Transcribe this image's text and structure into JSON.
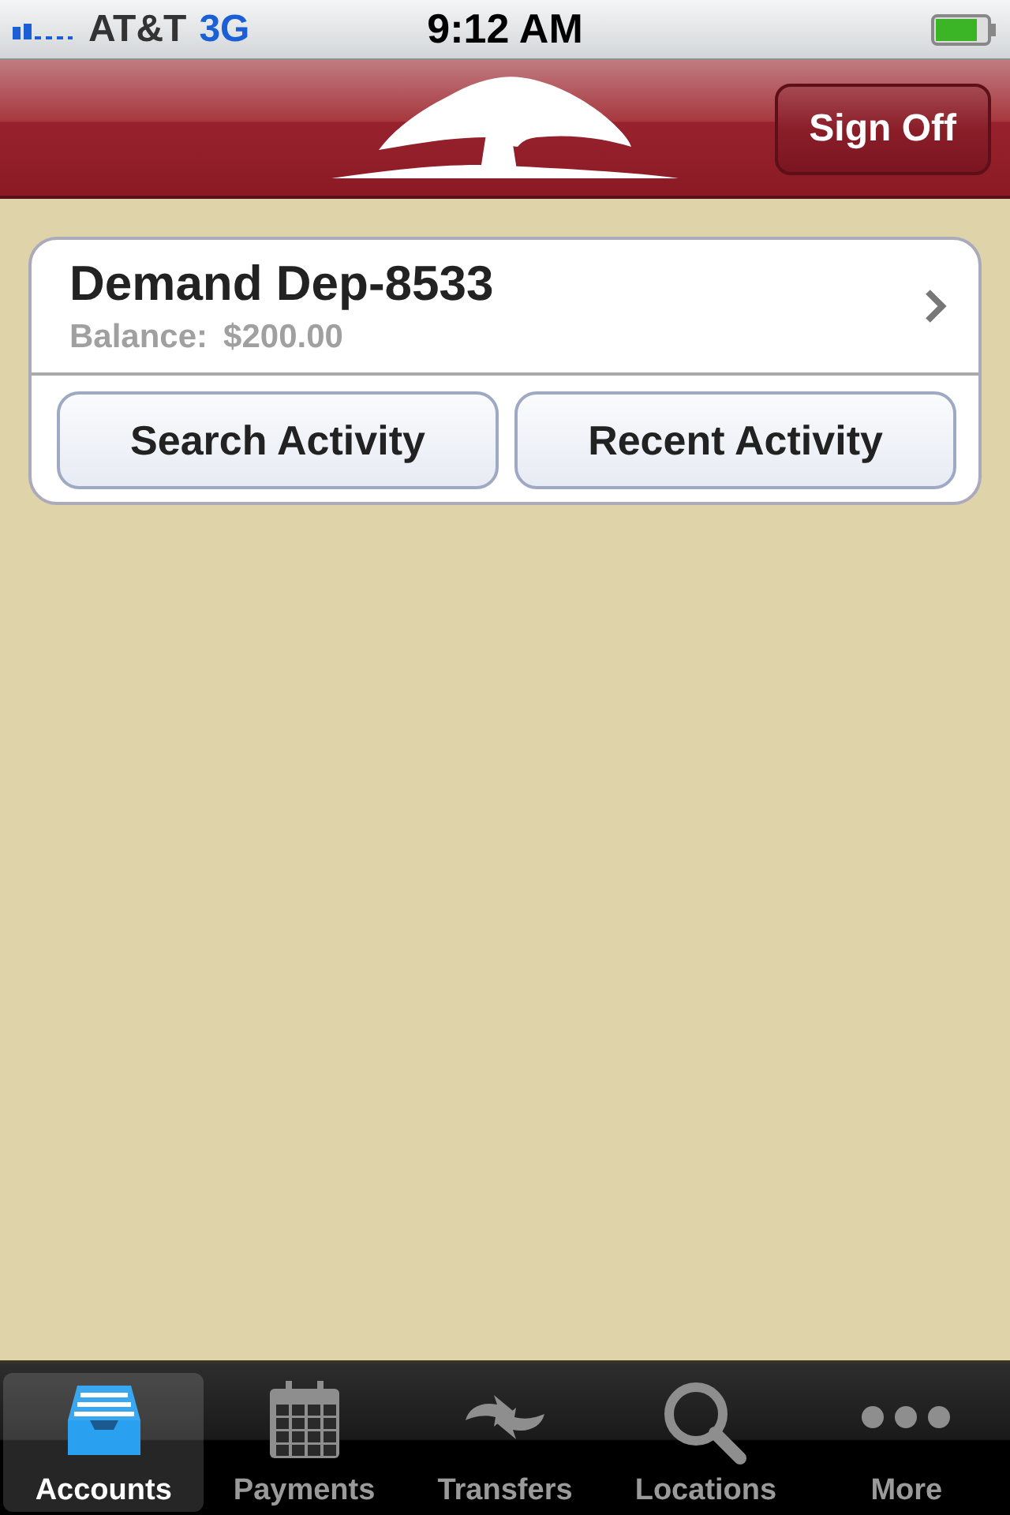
{
  "status_bar": {
    "carrier": "AT&T",
    "network": "3G",
    "time": "9:12 AM"
  },
  "nav_bar": {
    "sign_off": "Sign Off"
  },
  "account": {
    "name": "Demand Dep-8533",
    "balance_label": "Balance:",
    "balance": "$200.00",
    "actions": [
      "Search Activity",
      "Recent Activity"
    ]
  },
  "tabs": [
    {
      "label": "Accounts",
      "kind": "accounts",
      "selected": true
    },
    {
      "label": "Payments",
      "kind": "payments",
      "selected": false
    },
    {
      "label": "Transfers",
      "kind": "transfers",
      "selected": false
    },
    {
      "label": "Locations",
      "kind": "locations",
      "selected": false
    },
    {
      "label": "More",
      "kind": "more",
      "selected": false
    }
  ]
}
